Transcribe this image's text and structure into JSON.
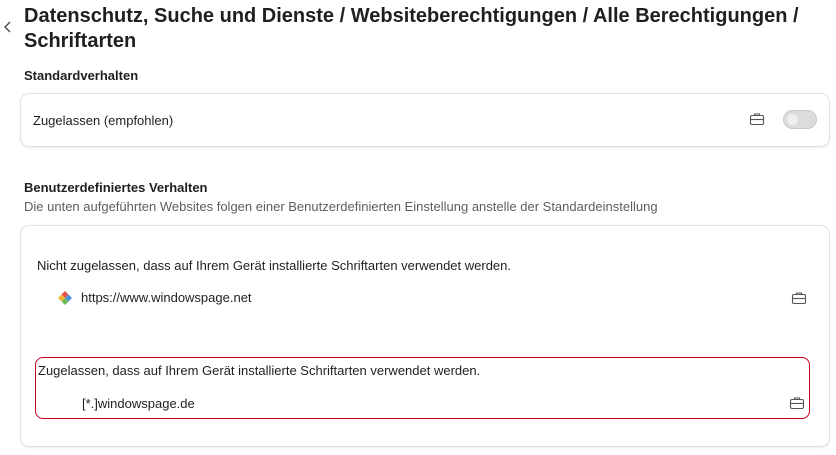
{
  "page": {
    "title": "Datenschutz, Suche und Dienste / Websiteberechtigungen / Alle Berechtigungen / Schriftarten"
  },
  "default_behavior": {
    "heading": "Standardverhalten",
    "setting_label": "Zugelassen (empfohlen)",
    "toggle_on": false
  },
  "custom_behavior": {
    "heading": "Benutzerdefiniertes Verhalten",
    "description": "Die unten aufgeführten Websites folgen einer Benutzerdefinierten Einstellung anstelle der Standardeinstellung",
    "blocked_group": {
      "label": "Nicht zugelassen, dass auf Ihrem Gerät installierte Schriftarten verwendet werden.",
      "sites": [
        "https://www.windowspage.net"
      ]
    },
    "allowed_group": {
      "label": "Zugelassen, dass auf Ihrem Gerät installierte Schriftarten verwendet werden.",
      "sites": [
        "[*.]windowspage.de"
      ]
    }
  },
  "icons": {
    "back": "chevron-left-icon",
    "managed": "briefcase-icon",
    "site_favicon": "windowspage-favicon-icon"
  },
  "colors": {
    "highlight_border": "#c4001a",
    "toggle_off": "#dcdcdc"
  }
}
